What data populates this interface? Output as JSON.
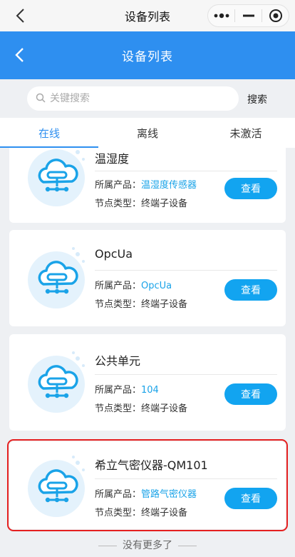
{
  "system_bar": {
    "title": "设备列表"
  },
  "header": {
    "title": "设备列表"
  },
  "search": {
    "placeholder": "关键搜索",
    "button_label": "搜索"
  },
  "tabs": [
    {
      "label": "在线",
      "active": true
    },
    {
      "label": "离线",
      "active": false
    },
    {
      "label": "未激活",
      "active": false
    }
  ],
  "labels": {
    "product": "所属产品：",
    "node_type": "节点类型：",
    "view": "查看"
  },
  "devices": [
    {
      "name": "温湿度",
      "product": "温湿度传感器",
      "node_type": "终端子设备"
    },
    {
      "name": "OpcUa",
      "product": "OpcUa",
      "node_type": "终端子设备"
    },
    {
      "name": "公共单元",
      "product": "104",
      "node_type": "终端子设备"
    },
    {
      "name": "希立气密仪器-QM101",
      "product": "管路气密仪器",
      "node_type": "终端子设备",
      "highlighted": true
    }
  ],
  "footer": {
    "text": "没有更多了"
  },
  "colors": {
    "primary": "#2e8ff0",
    "button": "#12a4f0",
    "link": "#1aa3e8",
    "highlight": "#e52020"
  }
}
